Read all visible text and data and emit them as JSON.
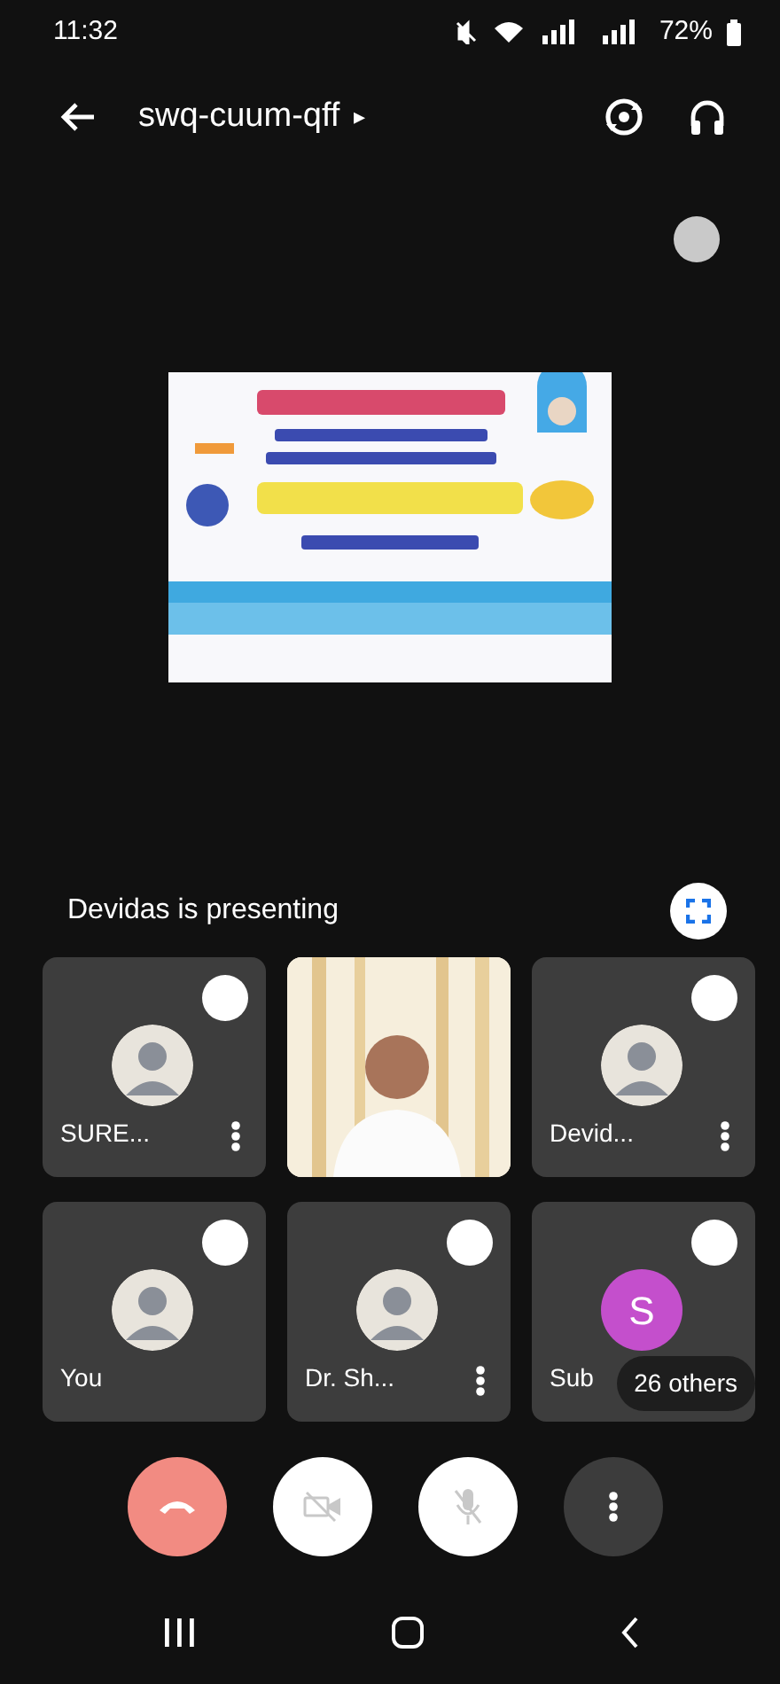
{
  "status_bar": {
    "time": "11:32",
    "battery": "72%"
  },
  "header": {
    "meeting_code": "swq-cuum-qff",
    "caret": "▸"
  },
  "presentation": {
    "kind": "picture",
    "caption": "Devidas is presenting"
  },
  "tiles": [
    {
      "kind": "avatar",
      "name": "SURE...",
      "menu": true
    },
    {
      "kind": "video",
      "menu": false
    },
    {
      "kind": "avatar",
      "name": "Devid...",
      "menu": true
    },
    {
      "kind": "avatar",
      "name": "You",
      "menu": false
    },
    {
      "kind": "avatar",
      "name": "Dr. Sh...",
      "menu": true
    },
    {
      "kind": "letter",
      "letter": "S",
      "color": "#c44fcc",
      "name": "Sub"
    }
  ],
  "others_chip": "26 others",
  "controls": [
    {
      "kind": "hangup"
    },
    {
      "kind": "camera",
      "on": false
    },
    {
      "kind": "mic",
      "on": false
    },
    {
      "kind": "more"
    }
  ]
}
